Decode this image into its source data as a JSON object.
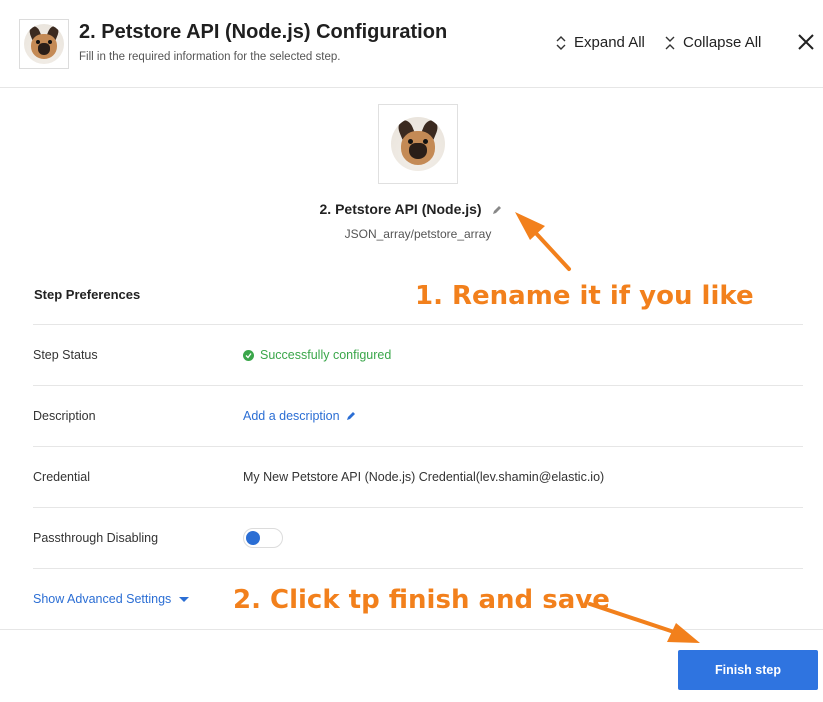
{
  "header": {
    "title": "2. Petstore API (Node.js) Configuration",
    "subtitle": "Fill in the required information for the selected step.",
    "expand_all": "Expand All",
    "collapse_all": "Collapse All"
  },
  "step": {
    "name": "2. Petstore API (Node.js)",
    "path": "JSON_array/petstore_array"
  },
  "preferences": {
    "title": "Step Preferences",
    "rows": [
      {
        "label": "Step Status",
        "value": "Successfully configured"
      },
      {
        "label": "Description",
        "value": "Add a description"
      },
      {
        "label": "Credential",
        "value": "My New Petstore API (Node.js) Credential(lev.shamin@elastic.io)"
      },
      {
        "label": "Passthrough Disabling",
        "value": ""
      }
    ],
    "advanced": "Show Advanced Settings"
  },
  "footer": {
    "finish_label": "Finish step"
  },
  "annotations": {
    "rename": "1. Rename it if you like",
    "finish": "2. Click tp finish and save"
  },
  "colors": {
    "accent": "#2f74e0",
    "link": "#2b6ed4",
    "success": "#3aa64a",
    "annotation": "#f2801c"
  },
  "icons": [
    "dog-avatar-icon",
    "chevron-expand-icon",
    "chevron-collapse-icon",
    "close-icon",
    "pencil-icon",
    "check-circle-icon",
    "caret-down-icon"
  ]
}
